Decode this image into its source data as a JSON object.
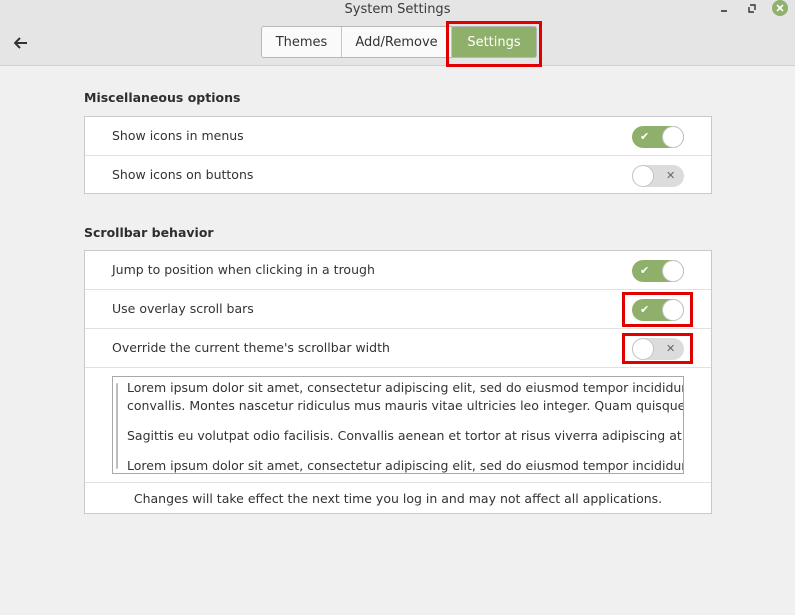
{
  "window": {
    "title": "System Settings"
  },
  "tabs": [
    {
      "label": "Themes",
      "active": false
    },
    {
      "label": "Add/Remove",
      "active": false
    },
    {
      "label": "Settings",
      "active": true
    }
  ],
  "misc": {
    "title": "Miscellaneous options",
    "rows": [
      {
        "label": "Show icons in menus",
        "enabled": true
      },
      {
        "label": "Show icons on buttons",
        "enabled": false
      }
    ]
  },
  "scrollbar": {
    "title": "Scrollbar behavior",
    "rows": [
      {
        "label": "Jump to position when clicking in a trough",
        "enabled": true
      },
      {
        "label": "Use overlay scroll bars",
        "enabled": true
      },
      {
        "label": "Override the current theme's scrollbar width",
        "enabled": false
      }
    ],
    "sample_text": [
      "Lorem ipsum dolor sit amet, consectetur adipiscing elit, sed do eiusmod tempor incididunt ut labore",
      "convallis. Montes nascetur ridiculus mus mauris vitae ultricies leo integer. Quam quisque id diam",
      "",
      "Sagittis eu volutpat odio facilisis. Convallis aenean et tortor at risus viverra adipiscing at. Sapien",
      "",
      "Lorem ipsum dolor sit amet, consectetur adipiscing elit, sed do eiusmod tempor incididunt ut labore"
    ],
    "note": "Changes will take effect the next time you log in and may not affect all applications."
  },
  "colors": {
    "accent": "#8fb06a",
    "highlight": "#e00000"
  }
}
